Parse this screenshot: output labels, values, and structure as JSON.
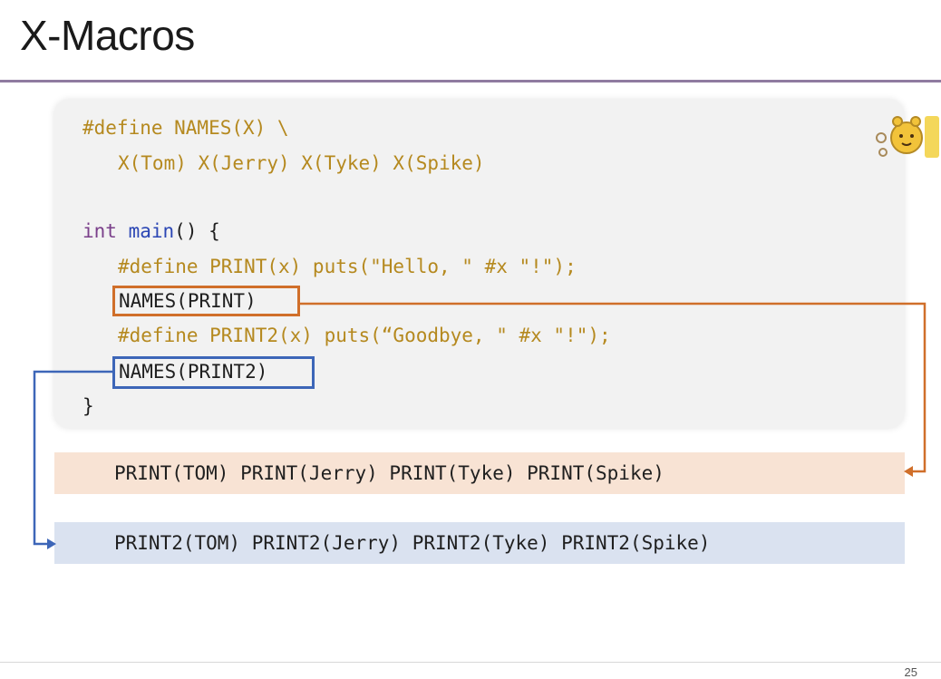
{
  "slide": {
    "title": "X-Macros",
    "page_number": "25"
  },
  "code": {
    "line1_pre": "#define NAMES(X) \\",
    "line2_pre": "X(Tom) X(Jerry) X(Tyke) X(Spike)",
    "line3_kw": "int",
    "line3_fn": "main",
    "line3_rest": "() {",
    "line4_pre": "#define PRINT(x) puts(\"Hello, \" #x \"!\");",
    "line5": "NAMES(PRINT)",
    "line6_pre": "#define PRINT2(x) puts(“Goodbye, \" #x \"!\");",
    "line7": "NAMES(PRINT2)",
    "line8": "}"
  },
  "results": {
    "expansion1": "PRINT(TOM) PRINT(Jerry) PRINT(Tyke) PRINT(Spike)",
    "expansion2": "PRINT2(TOM) PRINT2(Jerry) PRINT2(Tyke) PRINT2(Spike)"
  },
  "colors": {
    "orange": "#d06f2a",
    "blue": "#3d66b8",
    "preprocessor": "#b5891f",
    "keyword": "#7a3f8a",
    "function": "#2b46b4"
  }
}
